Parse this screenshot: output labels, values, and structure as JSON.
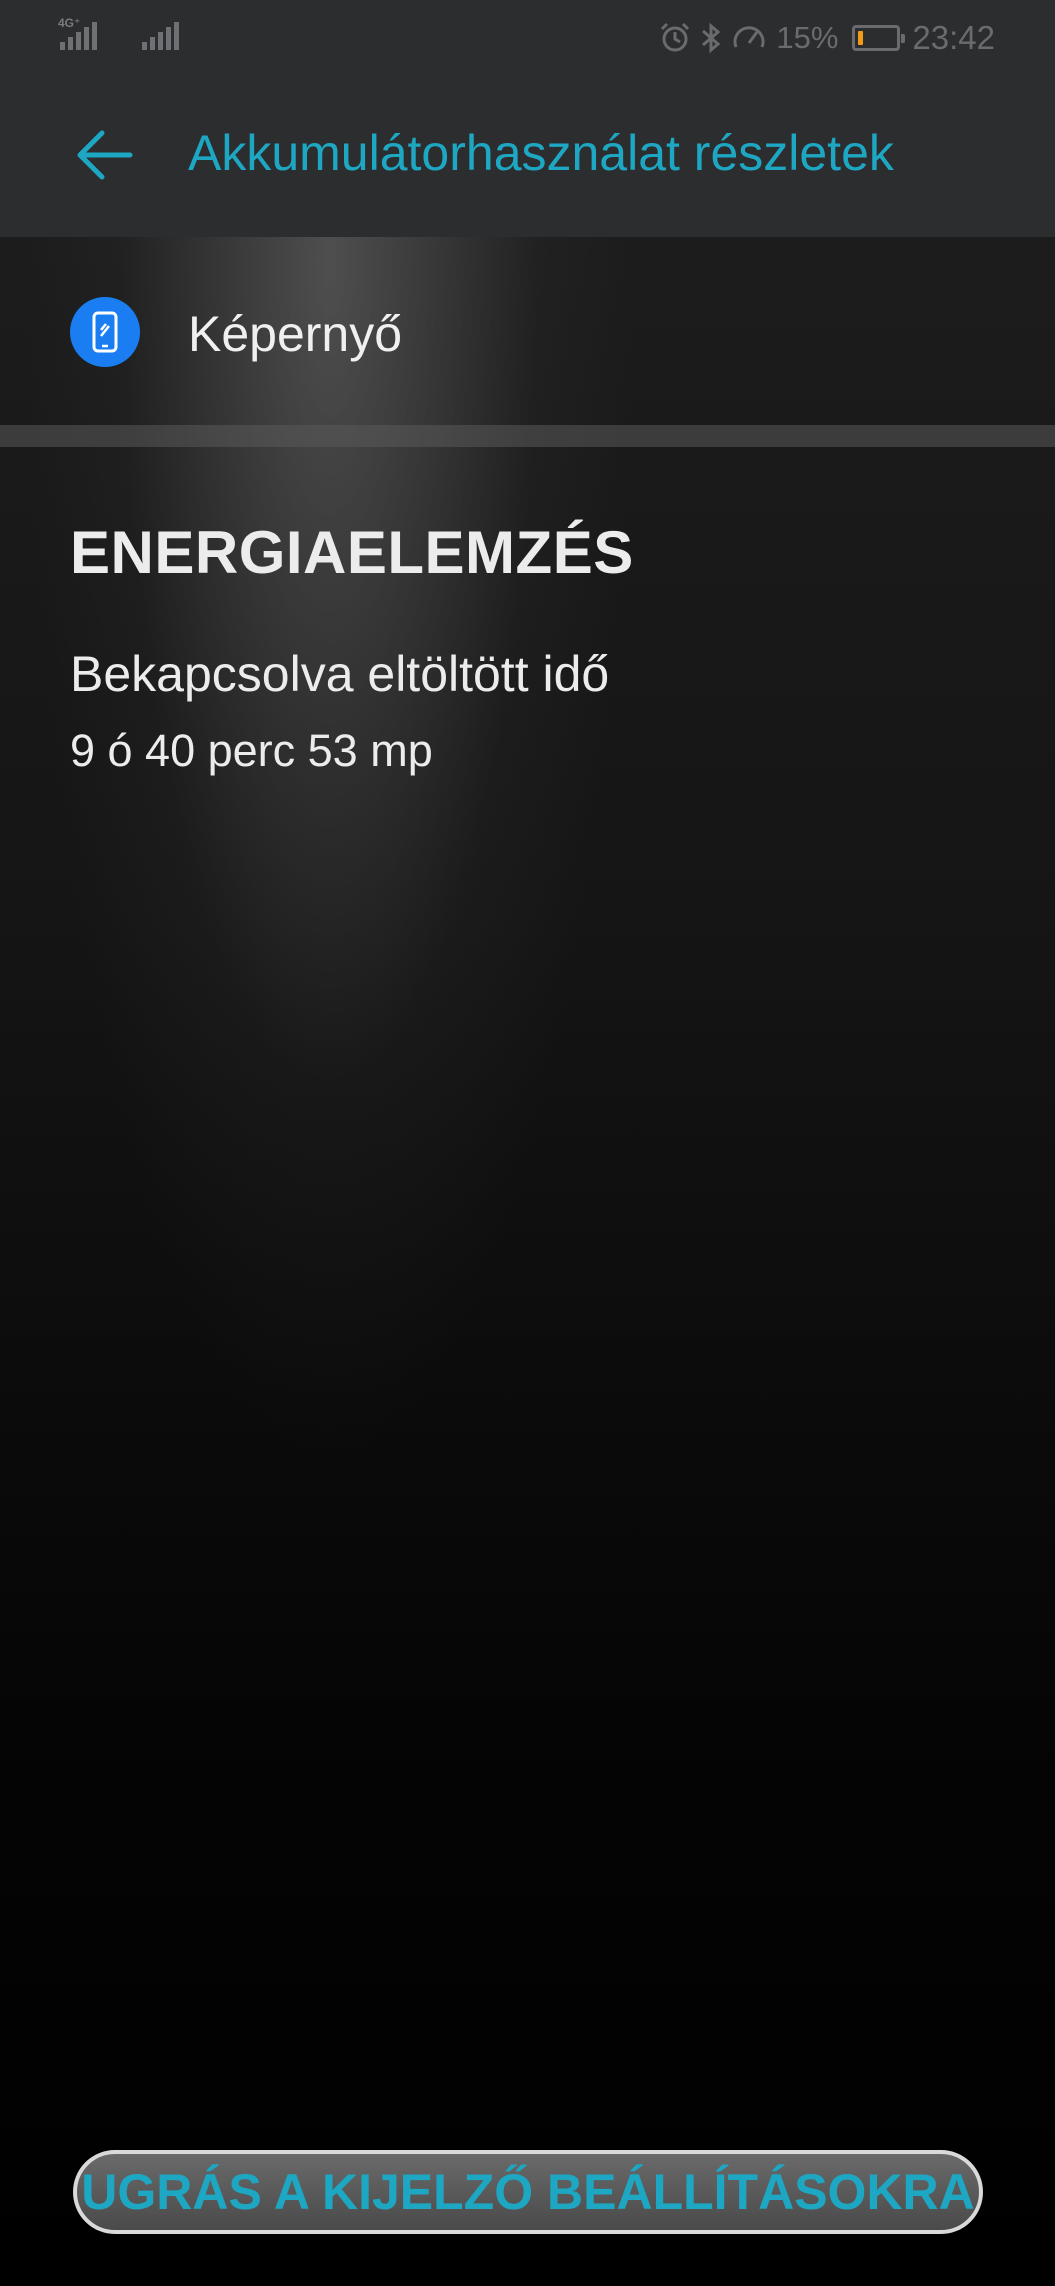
{
  "status_bar": {
    "network": "4G⁺",
    "battery_percent": "15%",
    "battery_level": 0.15,
    "time": "23:42",
    "icons": [
      "signal-icon",
      "signal-icon",
      "alarm-icon",
      "bluetooth-icon",
      "data-saver-icon",
      "battery-icon"
    ]
  },
  "header": {
    "title": "Akkumulátorhasználat részletek",
    "back_icon": "arrow-left-icon"
  },
  "item": {
    "label": "Képernyő",
    "icon": "phone-screen-icon",
    "icon_color": "#1a7ef2"
  },
  "energy": {
    "section_title": "ENERGIAELEMZÉS",
    "stat_label": "Bekapcsolva eltöltött idő",
    "stat_value": "9 ó 40 perc 53 mp"
  },
  "footer": {
    "button_label": "UGRÁS A KIJELZŐ BEÁLLÍTÁSOKRA"
  },
  "colors": {
    "accent": "#1ea7c2",
    "bar_bg": "#2c2d2f",
    "battery_fill": "#f29b17"
  }
}
